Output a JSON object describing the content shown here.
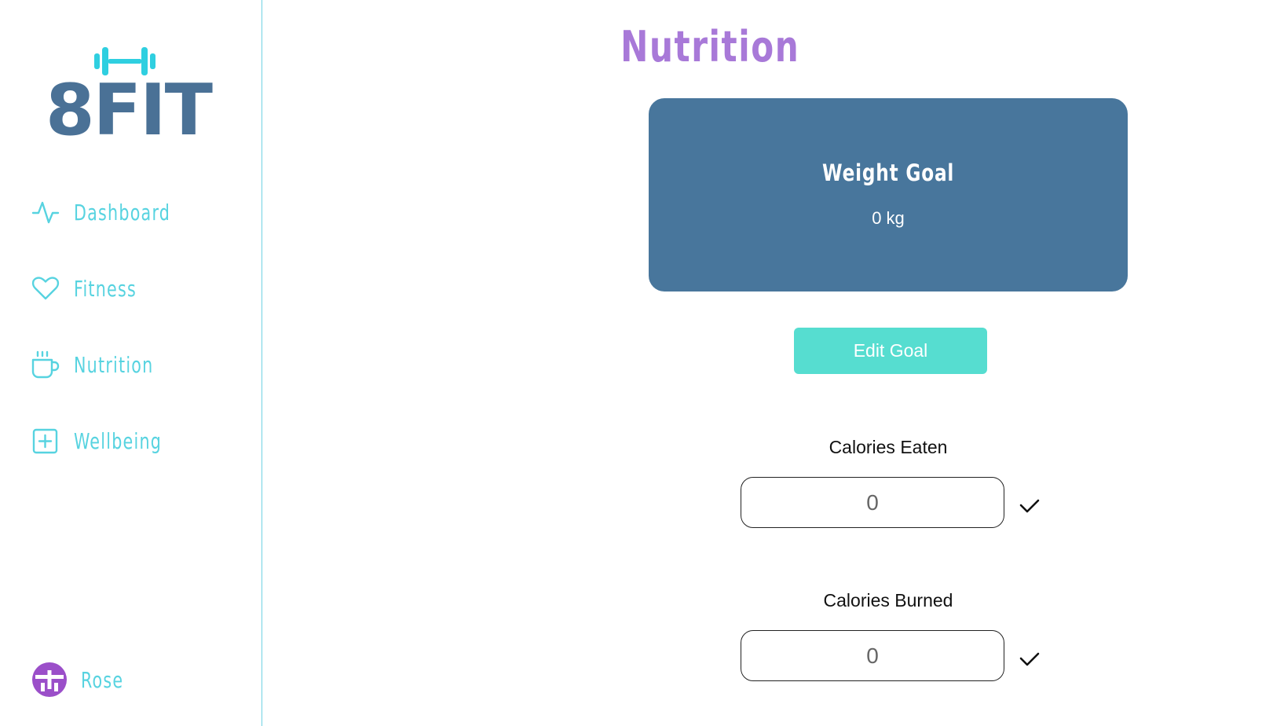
{
  "brand": {
    "name": "8FIT",
    "logo_icon": "dumbbell-icon",
    "colors": {
      "logo_text": "#4a7196",
      "logo_icon": "#2fcfe0"
    }
  },
  "sidebar": {
    "items": [
      {
        "label": "Dashboard",
        "icon": "activity-icon"
      },
      {
        "label": "Fitness",
        "icon": "heart-icon"
      },
      {
        "label": "Nutrition",
        "icon": "coffee-cup-icon"
      },
      {
        "label": "Wellbeing",
        "icon": "plus-square-icon"
      }
    ],
    "accent_color": "#57d3e0"
  },
  "user": {
    "name": "Rose",
    "avatar_icon": "user-avatar-icon",
    "avatar_color": "#9b4fc9"
  },
  "main": {
    "title": "Nutrition",
    "title_color": "#a879d8",
    "goal_card": {
      "title": "Weight Goal",
      "value": "0 kg",
      "background": "#48769c"
    },
    "edit_button": {
      "label": "Edit Goal",
      "color": "#56ddd0"
    },
    "calories_eaten": {
      "label": "Calories Eaten",
      "placeholder": "0",
      "confirm_icon": "check-icon"
    },
    "calories_burned": {
      "label": "Calories Burned",
      "placeholder": "0",
      "confirm_icon": "check-icon"
    }
  }
}
